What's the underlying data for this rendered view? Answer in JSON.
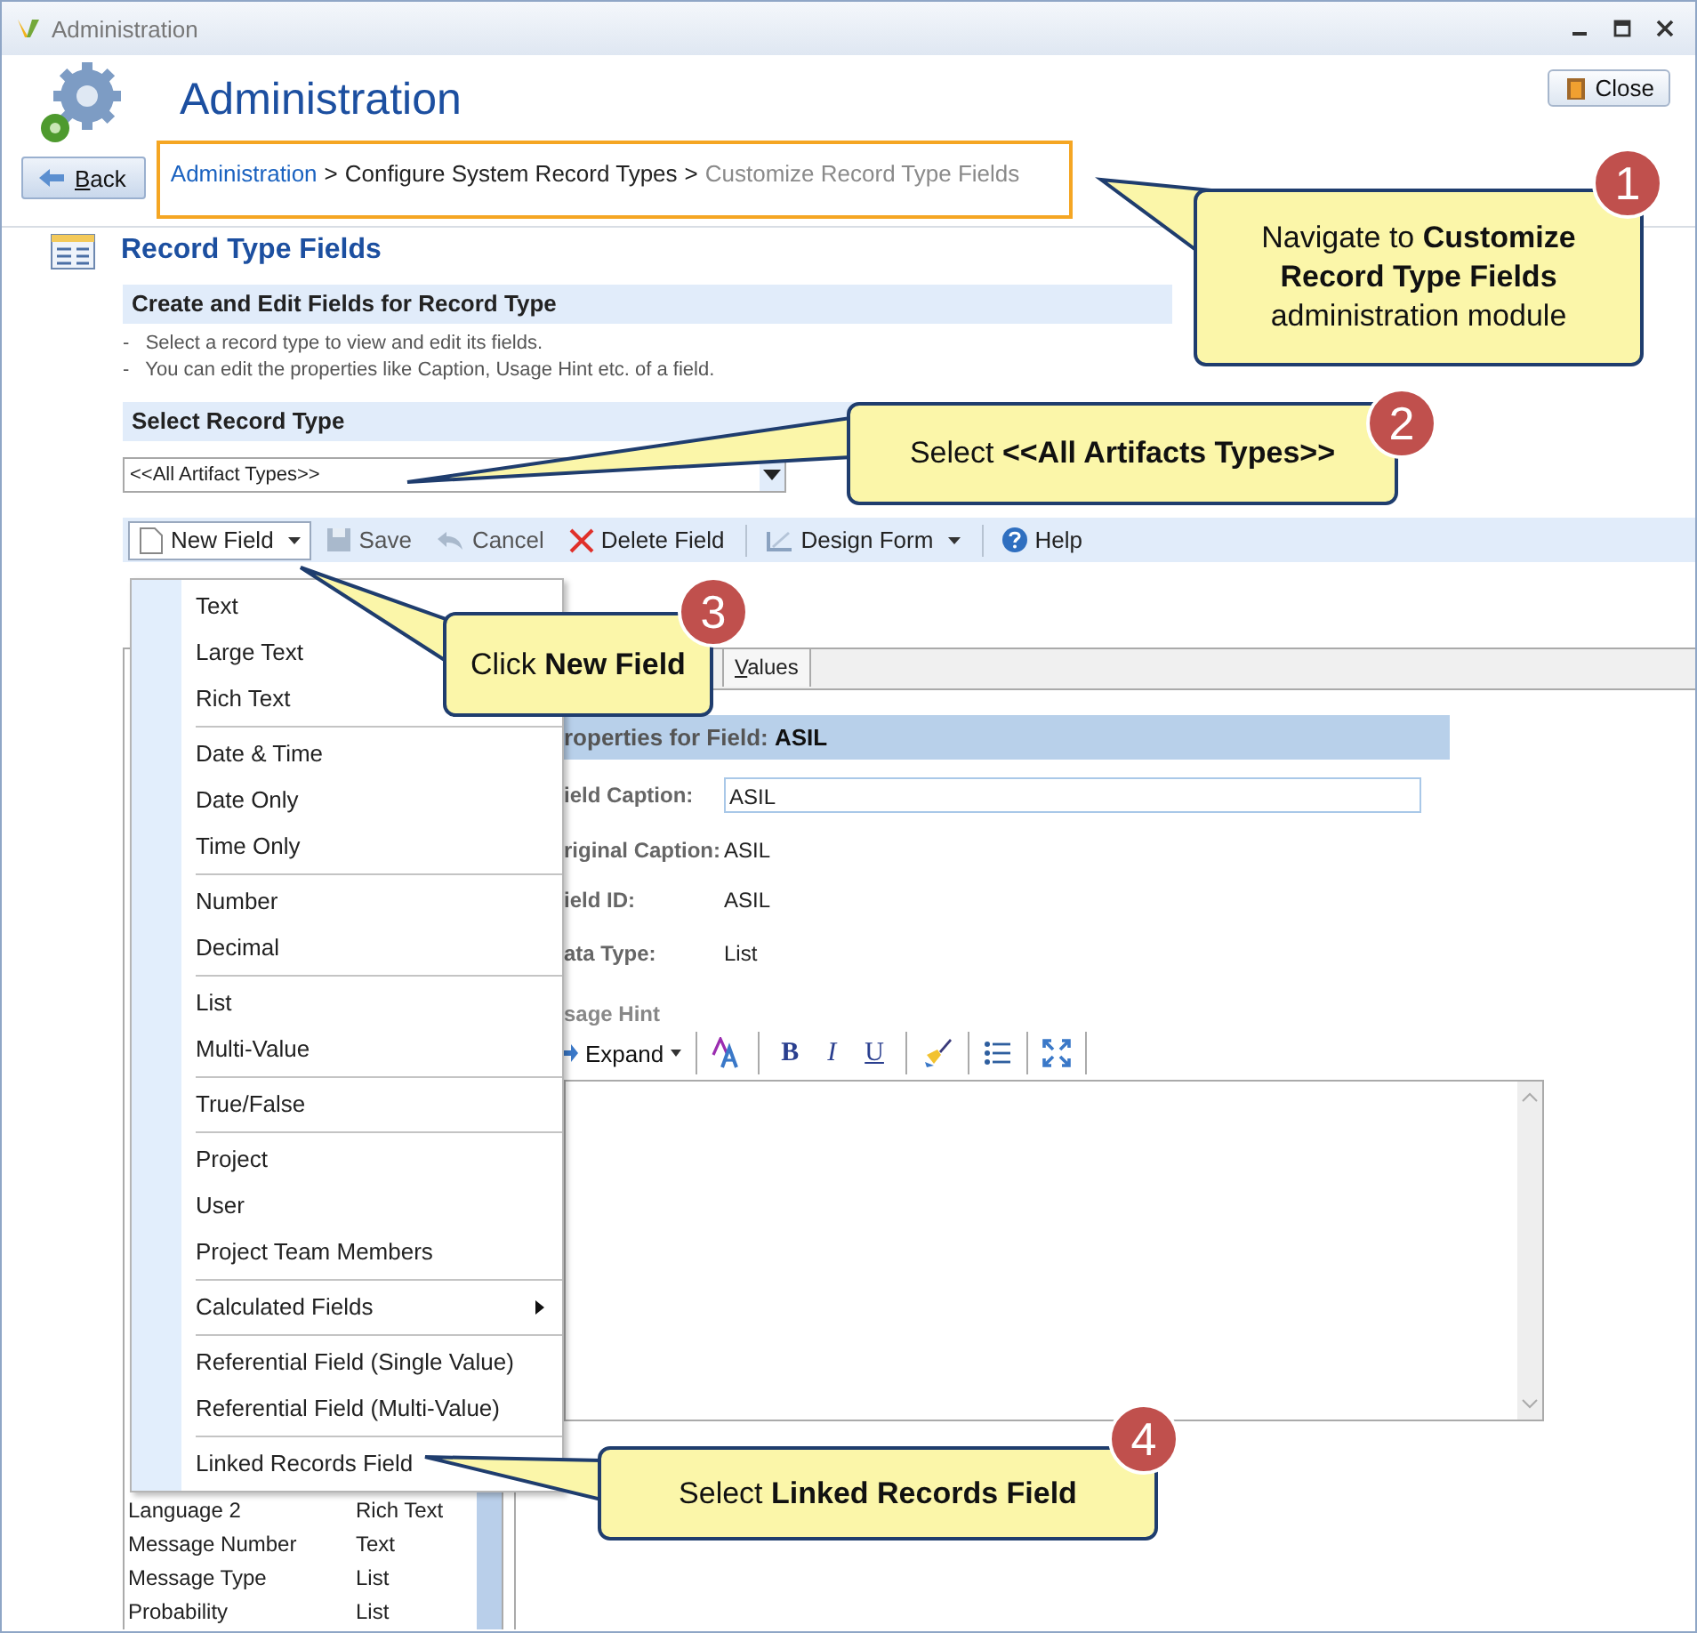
{
  "window": {
    "title": "Administration"
  },
  "header": {
    "title": "Administration",
    "close_button": "Close",
    "back_button": "Back"
  },
  "breadcrumb": [
    {
      "label": "Administration",
      "kind": "link"
    },
    {
      "label": ">",
      "kind": "sep"
    },
    {
      "label": "Configure System Record Types",
      "kind": "plain"
    },
    {
      "label": ">",
      "kind": "sep"
    },
    {
      "label": "Customize Record Type Fields",
      "kind": "current"
    }
  ],
  "section": {
    "title": "Record Type Fields",
    "box_title": "Create and Edit Fields for Record Type",
    "notes": [
      "-   Select a record type to view and edit its fields.",
      "-   You can edit the properties like Caption, Usage Hint etc. of a field."
    ],
    "select_title": "Select Record Type",
    "select_value": "<<All Artifact Types>>"
  },
  "toolbar": [
    {
      "label": "New Field",
      "kind": "new",
      "disabled": false,
      "caret": true,
      "open": true
    },
    {
      "label": "Save",
      "kind": "save",
      "disabled": true,
      "caret": false,
      "open": false
    },
    {
      "label": "Cancel",
      "kind": "cancel",
      "disabled": true,
      "caret": false,
      "open": false
    },
    {
      "label": "Delete Field",
      "kind": "delete",
      "disabled": false,
      "caret": false,
      "open": false
    },
    {
      "label": "Design Form",
      "kind": "design",
      "disabled": false,
      "caret": true,
      "open": false
    },
    {
      "label": "Help",
      "kind": "help",
      "disabled": false,
      "caret": false,
      "open": false
    }
  ],
  "menu": [
    [
      "Text",
      "Large Text",
      "Rich Text"
    ],
    [
      "Date & Time",
      "Date Only",
      "Time Only"
    ],
    [
      "Number",
      "Decimal"
    ],
    [
      "List",
      "Multi-Value"
    ],
    [
      "True/False"
    ],
    [
      "Project",
      "User",
      "Project Team Members"
    ],
    [
      {
        "label": "Calculated Fields",
        "submenu": true
      }
    ],
    [
      "Referential Field (Single Value)",
      "Referential Field (Multi-Value)"
    ],
    [
      "Linked Records Field"
    ]
  ],
  "field_list": [
    {
      "name": "Language 2",
      "type": "Rich Text"
    },
    {
      "name": "Message Number",
      "type": "Text"
    },
    {
      "name": "Message Type",
      "type": "List"
    },
    {
      "name": "Probability",
      "type": "List"
    }
  ],
  "tab": {
    "label": "Values"
  },
  "properties": {
    "title": "roperties for Field: ",
    "field": "ASIL",
    "rows": [
      {
        "label": "ield Caption:",
        "value": "ASIL",
        "kind": "input"
      },
      {
        "label": "riginal Caption:",
        "value": "ASIL",
        "kind": "text"
      },
      {
        "label": "ield ID:",
        "value": "ASIL",
        "kind": "text"
      },
      {
        "label": "ata Type:",
        "value": "List",
        "kind": "text"
      }
    ],
    "hint_label": "sage Hint",
    "expand": "Expand",
    "format_buttons": [
      {
        "label": "B",
        "kind": "bold"
      },
      {
        "label": "I",
        "kind": "italic"
      },
      {
        "label": "U",
        "kind": "underline"
      }
    ]
  },
  "callouts": [
    {
      "number": "1",
      "text": "Navigate to **Customize Record Type Fields** administration module"
    },
    {
      "number": "2",
      "text": "Select **<<All Artifacts Types>>**"
    },
    {
      "number": "3",
      "text": "Click **New Field**"
    },
    {
      "number": "4",
      "text": "Select **Linked Records Field**"
    }
  ]
}
